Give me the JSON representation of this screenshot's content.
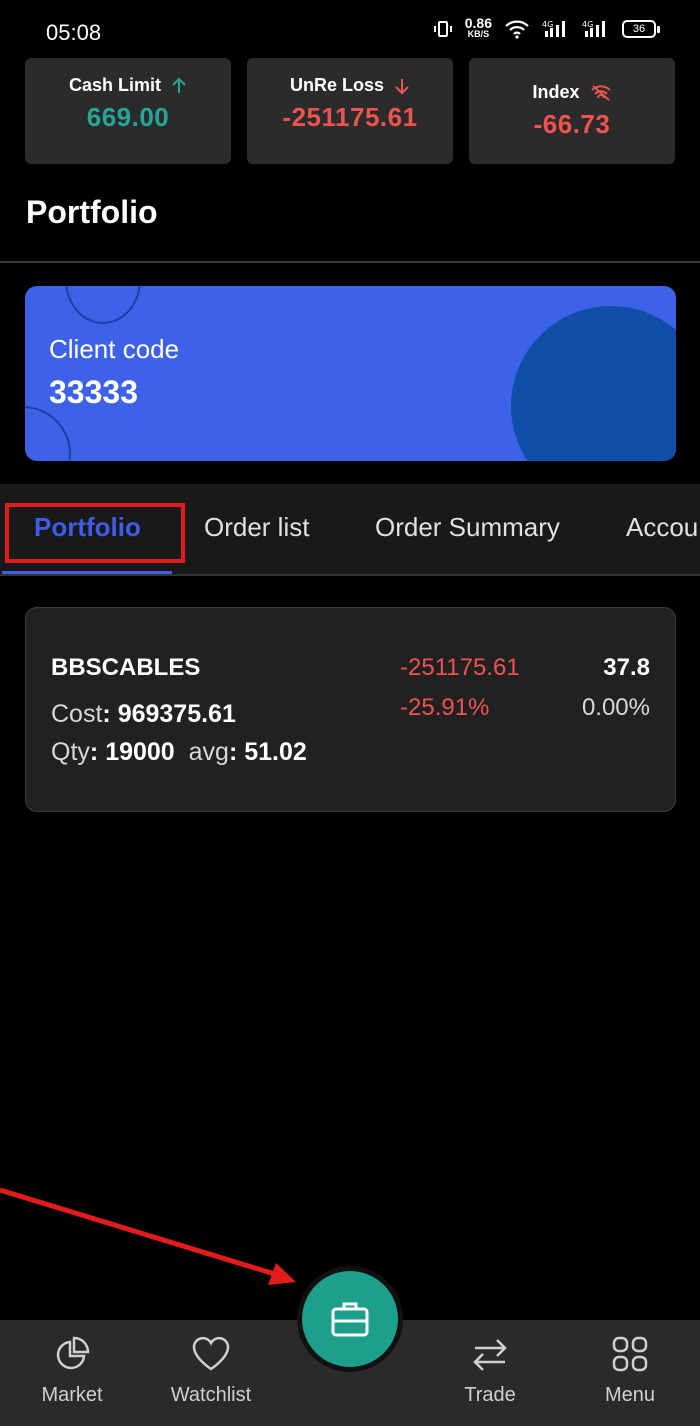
{
  "status": {
    "time": "05:08",
    "speed": "0.86",
    "speed_unit": "KB/S",
    "battery": "36"
  },
  "stats": [
    {
      "label": "Cash Limit",
      "value": "669.00",
      "trend": "up",
      "color": "#26a69a",
      "icon": "arrow-up-icon"
    },
    {
      "label": "UnRe Loss",
      "value": "-251175.61",
      "trend": "down",
      "color": "#ef5350",
      "icon": "arrow-down-icon"
    },
    {
      "label": "Index",
      "value": "-66.73",
      "trend": "offline",
      "color": "#ef5350",
      "icon": "wifi-off-icon"
    }
  ],
  "page_title": "Portfolio",
  "client": {
    "label": "Client code",
    "code": "33333"
  },
  "tabs": [
    {
      "label": "Portfolio",
      "active": true
    },
    {
      "label": "Order list"
    },
    {
      "label": "Order Summary"
    },
    {
      "label": "Accou"
    }
  ],
  "holding": {
    "symbol": "BBSCABLES",
    "cost_label": "Cost",
    "cost": "969375.61",
    "qty_label": "Qty",
    "qty": "19000",
    "avg_label": "avg",
    "avg": "51.02",
    "pl": "-251175.61",
    "pl_pct": "-25.91%",
    "ltp": "37.8",
    "change_pct": "0.00%"
  },
  "nav": [
    {
      "label": "Market",
      "icon": "pie-chart-icon"
    },
    {
      "label": "Watchlist",
      "icon": "heart-icon"
    },
    {
      "label": "",
      "icon": "briefcase-icon"
    },
    {
      "label": "Trade",
      "icon": "swap-arrows-icon"
    },
    {
      "label": "Menu",
      "icon": "grid-icon"
    }
  ],
  "colors": {
    "accent": "#3e5de8",
    "card_blue": "#3d62e8",
    "fab": "#1e9f8b",
    "loss": "#ef5350",
    "gain": "#26a69a",
    "annotation": "#e21b1b"
  }
}
